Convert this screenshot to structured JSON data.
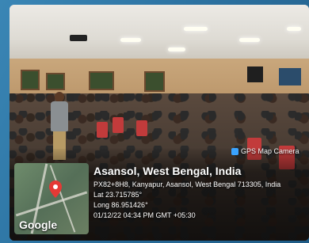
{
  "badge": {
    "label": "GPS Map Camera",
    "icon": "gps-camera-icon",
    "color": "#3aa3ff"
  },
  "location": {
    "title": "Asansol, West Bengal, India",
    "address": "PX82+8H8, Kanyapur, Asansol, West Bengal 713305, India",
    "lat": "Lat 23.715785°",
    "long": "Long 86.951426°",
    "datetime": "01/12/22 04:34 PM GMT +05:30"
  },
  "map": {
    "logo": "Google",
    "pin_icon": "map-pin-icon",
    "pin_color": "#e53935"
  }
}
